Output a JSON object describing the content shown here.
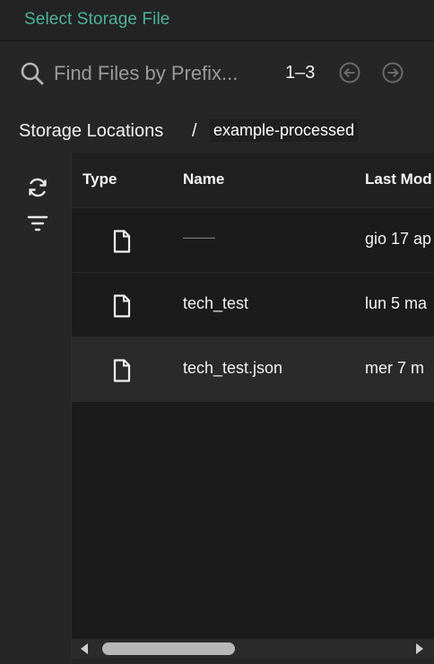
{
  "header": {
    "title": "Select Storage File"
  },
  "search": {
    "placeholder": "Find Files by Prefix...",
    "range": "1–3"
  },
  "breadcrumb": {
    "root": "Storage Locations",
    "separator": "/",
    "current": "example-processed"
  },
  "toolbar": {
    "refresh_icon": "refresh-icon",
    "filter_icon": "filter-icon"
  },
  "table": {
    "columns": [
      "Type",
      "Name",
      "Last Mod"
    ],
    "rows": [
      {
        "type_icon": "file-icon",
        "name": "——",
        "last_modified": "gio 17 ap"
      },
      {
        "type_icon": "file-icon",
        "name": "tech_test",
        "last_modified": "lun 5 ma"
      },
      {
        "type_icon": "file-icon",
        "name": "tech_test.json",
        "last_modified": "mer 7 m"
      }
    ]
  },
  "colors": {
    "accent": "#4cb39a",
    "background": "#1b1b1b",
    "panel": "#262626",
    "selected_row": "#2a2a2a"
  }
}
